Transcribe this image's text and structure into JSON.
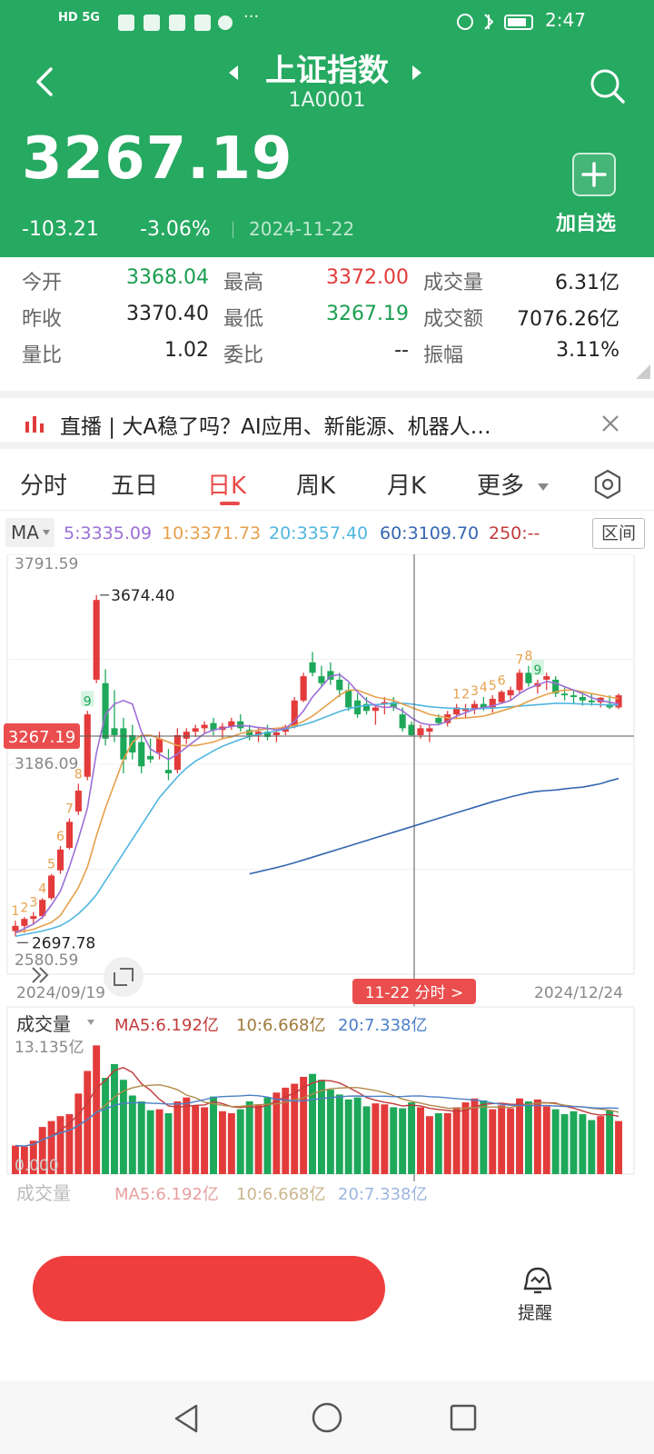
{
  "status_bar": {
    "left_icons": "HD 5G",
    "time": "2:47"
  },
  "header": {
    "title": "上证指数",
    "code": "1A0001",
    "price": "3267.19",
    "change": "-103.21",
    "change_pct": "-3.06%",
    "date": "2024-11-22",
    "add_label": "加自选",
    "bg_color": "#26a961"
  },
  "stats": {
    "rows": [
      [
        {
          "label": "今开",
          "value": "3368.04",
          "color": "#1a9e50"
        },
        {
          "label": "最高",
          "value": "3372.00",
          "color": "#e33b3b"
        },
        {
          "label": "成交量",
          "value": "6.31亿",
          "color": "#222"
        }
      ],
      [
        {
          "label": "昨收",
          "value": "3370.40",
          "color": "#222"
        },
        {
          "label": "最低",
          "value": "3267.19",
          "color": "#1a9e50"
        },
        {
          "label": "成交额",
          "value": "7076.26亿",
          "color": "#222"
        }
      ],
      [
        {
          "label": "量比",
          "value": "1.02",
          "color": "#222"
        },
        {
          "label": "委比",
          "value": "--",
          "color": "#222"
        },
        {
          "label": "振幅",
          "value": "3.11%",
          "color": "#222"
        }
      ]
    ]
  },
  "news": {
    "text": "直播 | 大A稳了吗？AI应用、新能源、机器人…"
  },
  "tabs": [
    "分时",
    "五日",
    "日K",
    "周K",
    "月K",
    "更多"
  ],
  "active_tab": "日K",
  "ma_bar": {
    "selector": "MA",
    "items": [
      {
        "text": "5:3335.09",
        "color": "#9b6fd6"
      },
      {
        "text": "10:3371.73",
        "color": "#e5a04a"
      },
      {
        "text": "20:3357.40",
        "color": "#4fb6e0"
      },
      {
        "text": "60:3109.70",
        "color": "#3466b0"
      },
      {
        "text": "250:--",
        "color": "#c23b3b"
      }
    ],
    "range_button": "区间"
  },
  "chart_data": {
    "type": "candlestick",
    "y_top_label": "3791.59",
    "y_mid_label": "3186.09",
    "y_bottom_label": "2580.59",
    "current_price_label": "3267.19",
    "high_label": "3674.40",
    "low_label": "2697.78",
    "ylim": [
      2580.59,
      3791.59
    ],
    "x_start": "2024/09/19",
    "x_end": "2024/12/24",
    "crosshair_tag": "11-22 分时 >",
    "candles": [
      {
        "o": 2705,
        "h": 2735,
        "l": 2690,
        "c": 2720
      },
      {
        "o": 2720,
        "h": 2745,
        "l": 2700,
        "c": 2740
      },
      {
        "o": 2740,
        "h": 2760,
        "l": 2725,
        "c": 2748
      },
      {
        "o": 2748,
        "h": 2800,
        "l": 2740,
        "c": 2795
      },
      {
        "o": 2800,
        "h": 2870,
        "l": 2795,
        "c": 2865
      },
      {
        "o": 2880,
        "h": 2950,
        "l": 2870,
        "c": 2940
      },
      {
        "o": 2945,
        "h": 3030,
        "l": 2940,
        "c": 3020
      },
      {
        "o": 3050,
        "h": 3130,
        "l": 3040,
        "c": 3110
      },
      {
        "o": 3150,
        "h": 3340,
        "l": 3140,
        "c": 3330
      },
      {
        "o": 3430,
        "h": 3674,
        "l": 3420,
        "c": 3660
      },
      {
        "o": 3420,
        "h": 3460,
        "l": 3240,
        "c": 3260
      },
      {
        "o": 3290,
        "h": 3400,
        "l": 3250,
        "c": 3270
      },
      {
        "o": 3290,
        "h": 3320,
        "l": 3160,
        "c": 3200
      },
      {
        "o": 3270,
        "h": 3300,
        "l": 3200,
        "c": 3220
      },
      {
        "o": 3250,
        "h": 3270,
        "l": 3160,
        "c": 3180
      },
      {
        "o": 3210,
        "h": 3260,
        "l": 3190,
        "c": 3200
      },
      {
        "o": 3220,
        "h": 3280,
        "l": 3200,
        "c": 3260
      },
      {
        "o": 3170,
        "h": 3230,
        "l": 3140,
        "c": 3160
      },
      {
        "o": 3170,
        "h": 3290,
        "l": 3160,
        "c": 3270
      },
      {
        "o": 3260,
        "h": 3290,
        "l": 3245,
        "c": 3280
      },
      {
        "o": 3280,
        "h": 3300,
        "l": 3265,
        "c": 3290
      },
      {
        "o": 3290,
        "h": 3310,
        "l": 3275,
        "c": 3300
      },
      {
        "o": 3305,
        "h": 3320,
        "l": 3270,
        "c": 3285
      },
      {
        "o": 3285,
        "h": 3305,
        "l": 3260,
        "c": 3295
      },
      {
        "o": 3295,
        "h": 3320,
        "l": 3285,
        "c": 3310
      },
      {
        "o": 3310,
        "h": 3330,
        "l": 3280,
        "c": 3290
      },
      {
        "o": 3285,
        "h": 3300,
        "l": 3255,
        "c": 3270
      },
      {
        "o": 3270,
        "h": 3290,
        "l": 3250,
        "c": 3280
      },
      {
        "o": 3280,
        "h": 3300,
        "l": 3255,
        "c": 3265
      },
      {
        "o": 3270,
        "h": 3285,
        "l": 3250,
        "c": 3278
      },
      {
        "o": 3280,
        "h": 3300,
        "l": 3270,
        "c": 3295
      },
      {
        "o": 3295,
        "h": 3380,
        "l": 3290,
        "c": 3370
      },
      {
        "o": 3370,
        "h": 3450,
        "l": 3365,
        "c": 3440
      },
      {
        "o": 3480,
        "h": 3510,
        "l": 3440,
        "c": 3450
      },
      {
        "o": 3440,
        "h": 3470,
        "l": 3410,
        "c": 3420
      },
      {
        "o": 3455,
        "h": 3480,
        "l": 3415,
        "c": 3430
      },
      {
        "o": 3430,
        "h": 3450,
        "l": 3380,
        "c": 3400
      },
      {
        "o": 3400,
        "h": 3420,
        "l": 3340,
        "c": 3350
      },
      {
        "o": 3370,
        "h": 3390,
        "l": 3320,
        "c": 3330
      },
      {
        "o": 3360,
        "h": 3380,
        "l": 3330,
        "c": 3340
      },
      {
        "o": 3340,
        "h": 3360,
        "l": 3300,
        "c": 3350
      },
      {
        "o": 3360,
        "h": 3380,
        "l": 3330,
        "c": 3365
      },
      {
        "o": 3365,
        "h": 3380,
        "l": 3340,
        "c": 3350
      },
      {
        "o": 3330,
        "h": 3350,
        "l": 3280,
        "c": 3290
      },
      {
        "o": 3300,
        "h": 3310,
        "l": 3267,
        "c": 3270
      },
      {
        "o": 3270,
        "h": 3300,
        "l": 3260,
        "c": 3290
      },
      {
        "o": 3280,
        "h": 3300,
        "l": 3250,
        "c": 3290
      },
      {
        "o": 3320,
        "h": 3330,
        "l": 3300,
        "c": 3305
      },
      {
        "o": 3305,
        "h": 3340,
        "l": 3295,
        "c": 3330
      },
      {
        "o": 3330,
        "h": 3360,
        "l": 3320,
        "c": 3350
      },
      {
        "o": 3340,
        "h": 3360,
        "l": 3320,
        "c": 3345
      },
      {
        "o": 3345,
        "h": 3370,
        "l": 3330,
        "c": 3360
      },
      {
        "o": 3360,
        "h": 3380,
        "l": 3340,
        "c": 3350
      },
      {
        "o": 3350,
        "h": 3385,
        "l": 3335,
        "c": 3375
      },
      {
        "o": 3365,
        "h": 3400,
        "l": 3360,
        "c": 3395
      },
      {
        "o": 3385,
        "h": 3410,
        "l": 3370,
        "c": 3400
      },
      {
        "o": 3400,
        "h": 3460,
        "l": 3390,
        "c": 3450
      },
      {
        "o": 3450,
        "h": 3470,
        "l": 3410,
        "c": 3420
      },
      {
        "o": 3410,
        "h": 3430,
        "l": 3390,
        "c": 3420
      },
      {
        "o": 3430,
        "h": 3450,
        "l": 3400,
        "c": 3440
      },
      {
        "o": 3430,
        "h": 3440,
        "l": 3380,
        "c": 3390
      },
      {
        "o": 3390,
        "h": 3410,
        "l": 3370,
        "c": 3385
      },
      {
        "o": 3385,
        "h": 3400,
        "l": 3360,
        "c": 3380
      },
      {
        "o": 3380,
        "h": 3395,
        "l": 3355,
        "c": 3370
      },
      {
        "o": 3370,
        "h": 3390,
        "l": 3355,
        "c": 3365
      },
      {
        "o": 3365,
        "h": 3380,
        "l": 3350,
        "c": 3378
      },
      {
        "o": 3360,
        "h": 3385,
        "l": 3345,
        "c": 3350
      },
      {
        "o": 3350,
        "h": 3390,
        "l": 3345,
        "c": 3385
      }
    ],
    "ma5": [
      2700,
      2712,
      2725,
      2745,
      2780,
      2820,
      2890,
      2970,
      3060,
      3220,
      3330,
      3360,
      3370,
      3360,
      3280,
      3230,
      3215,
      3200,
      3215,
      3235,
      3255,
      3275,
      3285,
      3290,
      3295,
      3298,
      3296,
      3292,
      3290,
      3285,
      3290,
      3310,
      3340,
      3380,
      3410,
      3440,
      3445,
      3425,
      3395,
      3370,
      3355,
      3350,
      3352,
      3340,
      3320,
      3305,
      3300,
      3300,
      3310,
      3325,
      3335,
      3345,
      3350,
      3355,
      3362,
      3370,
      3390,
      3405,
      3415,
      3425,
      3420,
      3410,
      3400,
      3390,
      3378,
      3370,
      3365,
      3360
    ],
    "ma10": [
      2700,
      2705,
      2710,
      2720,
      2730,
      2750,
      2790,
      2830,
      2890,
      2980,
      3060,
      3130,
      3200,
      3250,
      3270,
      3270,
      3260,
      3250,
      3240,
      3240,
      3240,
      3245,
      3250,
      3260,
      3265,
      3275,
      3280,
      3285,
      3288,
      3290,
      3292,
      3298,
      3310,
      3325,
      3345,
      3365,
      3385,
      3400,
      3400,
      3390,
      3380,
      3375,
      3370,
      3360,
      3350,
      3340,
      3330,
      3325,
      3320,
      3318,
      3320,
      3322,
      3325,
      3332,
      3340,
      3348,
      3356,
      3368,
      3378,
      3388,
      3395,
      3400,
      3400,
      3395,
      3390,
      3385,
      3380,
      3375
    ],
    "ma20": [
      2690,
      2695,
      2700,
      2705,
      2712,
      2720,
      2735,
      2755,
      2780,
      2810,
      2850,
      2890,
      2930,
      2970,
      3010,
      3050,
      3090,
      3120,
      3150,
      3175,
      3195,
      3210,
      3225,
      3238,
      3248,
      3258,
      3266,
      3272,
      3278,
      3282,
      3288,
      3294,
      3300,
      3308,
      3318,
      3328,
      3338,
      3346,
      3352,
      3356,
      3358,
      3360,
      3362,
      3362,
      3360,
      3356,
      3352,
      3350,
      3348,
      3347,
      3346,
      3346,
      3347,
      3348,
      3350,
      3352,
      3354,
      3356,
      3358,
      3360,
      3362,
      3362,
      3361,
      3360,
      3359,
      3358,
      3357,
      3357
    ],
    "ma60_start_index": 26,
    "ma60": [
      2870,
      2876,
      2882,
      2888,
      2895,
      2902,
      2910,
      2918,
      2926,
      2934,
      2942,
      2950,
      2958,
      2966,
      2974,
      2982,
      2990,
      2998,
      3006,
      3014,
      3022,
      3030,
      3038,
      3046,
      3054,
      3062,
      3070,
      3078,
      3085,
      3092,
      3098,
      3104,
      3108,
      3110,
      3112,
      3115,
      3118,
      3120,
      3125,
      3130,
      3138,
      3145
    ],
    "td_markers_up": [
      {
        "i": 0,
        "t": "1"
      },
      {
        "i": 1,
        "t": "2"
      },
      {
        "i": 2,
        "t": "3"
      },
      {
        "i": 3,
        "t": "4"
      },
      {
        "i": 4,
        "t": "5"
      },
      {
        "i": 5,
        "t": "6"
      },
      {
        "i": 6,
        "t": "7"
      },
      {
        "i": 7,
        "t": "8"
      },
      {
        "i": 8,
        "t": "9"
      },
      {
        "i": 49,
        "t": "1"
      },
      {
        "i": 50,
        "t": "2"
      },
      {
        "i": 51,
        "t": "3"
      },
      {
        "i": 52,
        "t": "4"
      },
      {
        "i": 53,
        "t": "5"
      },
      {
        "i": 54,
        "t": "6"
      },
      {
        "i": 56,
        "t": "7"
      },
      {
        "i": 57,
        "t": "8"
      },
      {
        "i": 58,
        "t": "9"
      }
    ],
    "volume": {
      "title": "成交量",
      "ma5_label": "MA5:6.192亿",
      "ma10_label": "10:6.668亿",
      "ma20_label": "20:7.338亿",
      "top_label": "13.135亿",
      "zero_label": "0.000",
      "ymax": 13.135,
      "bars": [
        2.9,
        2.8,
        3.4,
        4.8,
        5.4,
        5.9,
        6.1,
        8.2,
        10.5,
        13.1,
        9.8,
        11.2,
        9.6,
        8.0,
        7.4,
        6.5,
        6.6,
        6.2,
        7.4,
        7.8,
        7.0,
        6.8,
        7.9,
        6.4,
        6.2,
        6.6,
        7.4,
        7.1,
        7.8,
        8.3,
        8.8,
        9.2,
        9.9,
        10.2,
        9.6,
        8.6,
        8.1,
        7.6,
        7.8,
        6.9,
        7.2,
        7.1,
        6.8,
        6.7,
        7.3,
        6.8,
        5.9,
        6.2,
        6.2,
        6.8,
        7.3,
        7.7,
        7.5,
        6.6,
        7.0,
        6.7,
        7.7,
        7.4,
        7.6,
        6.9,
        6.6,
        6.1,
        6.4,
        6.1,
        5.5,
        5.9,
        6.5,
        5.4
      ]
    }
  },
  "bottom": {
    "reminder_label": "提醒"
  }
}
